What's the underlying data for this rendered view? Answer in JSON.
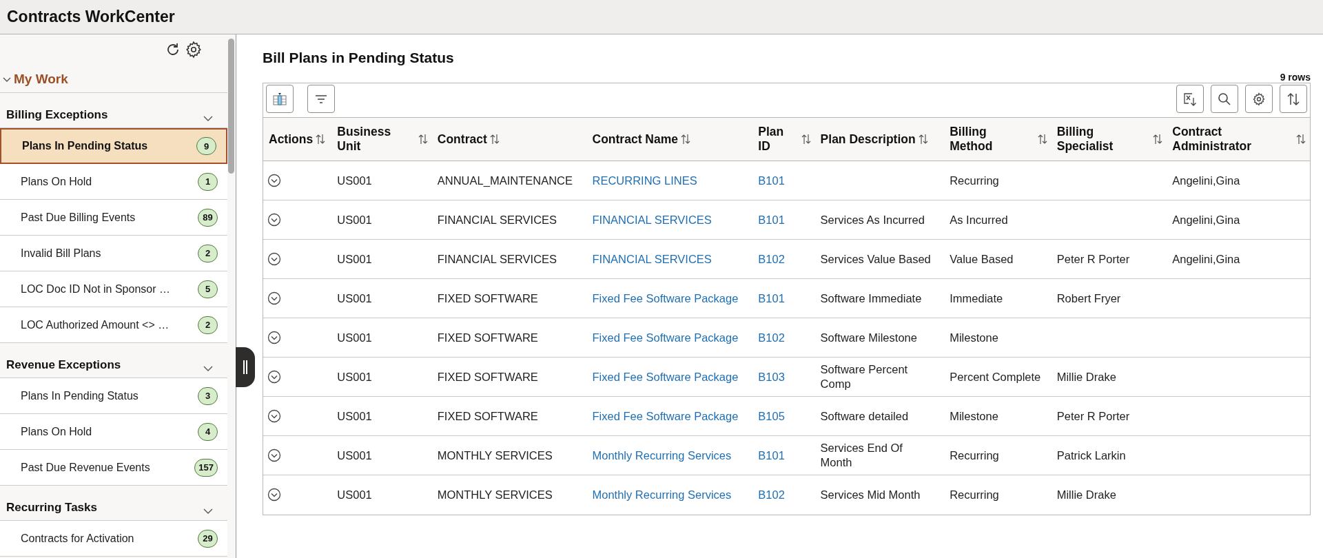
{
  "header": {
    "title": "Contracts WorkCenter"
  },
  "sidebar": {
    "section": {
      "label": "My Work",
      "expanded": true
    },
    "groups": [
      {
        "title": "Billing Exceptions",
        "items": [
          {
            "label": "Plans In Pending Status",
            "count": "9",
            "selected": true
          },
          {
            "label": "Plans On Hold",
            "count": "1",
            "selected": false
          },
          {
            "label": "Past Due Billing Events",
            "count": "89",
            "selected": false
          },
          {
            "label": "Invalid Bill Plans",
            "count": "2",
            "selected": false
          },
          {
            "label": "LOC Doc ID Not in Sponsor …",
            "count": "5",
            "selected": false
          },
          {
            "label": "LOC Authorized Amount <> …",
            "count": "2",
            "selected": false
          }
        ]
      },
      {
        "title": "Revenue Exceptions",
        "items": [
          {
            "label": "Plans In Pending Status",
            "count": "3",
            "selected": false
          },
          {
            "label": "Plans On Hold",
            "count": "4",
            "selected": false
          },
          {
            "label": "Past Due Revenue Events",
            "count": "157",
            "selected": false
          }
        ]
      },
      {
        "title": "Recurring Tasks",
        "items": [
          {
            "label": "Contracts for Activation",
            "count": "29",
            "selected": false
          }
        ]
      }
    ]
  },
  "main": {
    "title": "Bill Plans in Pending Status",
    "row_count": "9 rows",
    "table": {
      "columns": [
        {
          "label": "Actions",
          "kind": "action"
        },
        {
          "label": "Business Unit",
          "kind": "text"
        },
        {
          "label": "Contract",
          "kind": "text"
        },
        {
          "label": "Contract Name",
          "kind": "link"
        },
        {
          "label": "Plan ID",
          "kind": "link"
        },
        {
          "label": "Plan Description",
          "kind": "text"
        },
        {
          "label": "Billing Method",
          "kind": "text"
        },
        {
          "label": "Billing Specialist",
          "kind": "text"
        },
        {
          "label": "Contract Administrator",
          "kind": "text"
        }
      ],
      "rows": [
        {
          "cells": [
            "",
            "US001",
            "ANNUAL_MAINTENANCE",
            "RECURRING LINES",
            "B101",
            "",
            "Recurring",
            "",
            "Angelini,Gina"
          ]
        },
        {
          "cells": [
            "",
            "US001",
            "FINANCIAL SERVICES",
            "FINANCIAL SERVICES",
            "B101",
            "Services As Incurred",
            "As Incurred",
            "",
            "Angelini,Gina"
          ]
        },
        {
          "cells": [
            "",
            "US001",
            "FINANCIAL SERVICES",
            "FINANCIAL SERVICES",
            "B102",
            "Services Value Based",
            "Value Based",
            "Peter R Porter",
            "Angelini,Gina"
          ]
        },
        {
          "cells": [
            "",
            "US001",
            "FIXED SOFTWARE",
            "Fixed Fee Software Package",
            "B101",
            "Software Immediate",
            "Immediate",
            "Robert Fryer",
            ""
          ]
        },
        {
          "cells": [
            "",
            "US001",
            "FIXED SOFTWARE",
            "Fixed Fee Software Package",
            "B102",
            "Software Milestone",
            "Milestone",
            "",
            ""
          ]
        },
        {
          "cells": [
            "",
            "US001",
            "FIXED SOFTWARE",
            "Fixed Fee Software Package",
            "B103",
            "Software Percent Comp",
            "Percent Complete",
            "Millie Drake",
            ""
          ]
        },
        {
          "cells": [
            "",
            "US001",
            "FIXED SOFTWARE",
            "Fixed Fee Software Package",
            "B105",
            "Software detailed",
            "Milestone",
            "Peter R Porter",
            ""
          ]
        },
        {
          "cells": [
            "",
            "US001",
            "MONTHLY SERVICES",
            "Monthly Recurring Services",
            "B101",
            "Services End Of Month",
            "Recurring",
            "Patrick Larkin",
            ""
          ]
        },
        {
          "cells": [
            "",
            "US001",
            "MONTHLY SERVICES",
            "Monthly Recurring Services",
            "B102",
            "Services Mid Month",
            "Recurring",
            "Millie Drake",
            ""
          ]
        }
      ]
    }
  }
}
